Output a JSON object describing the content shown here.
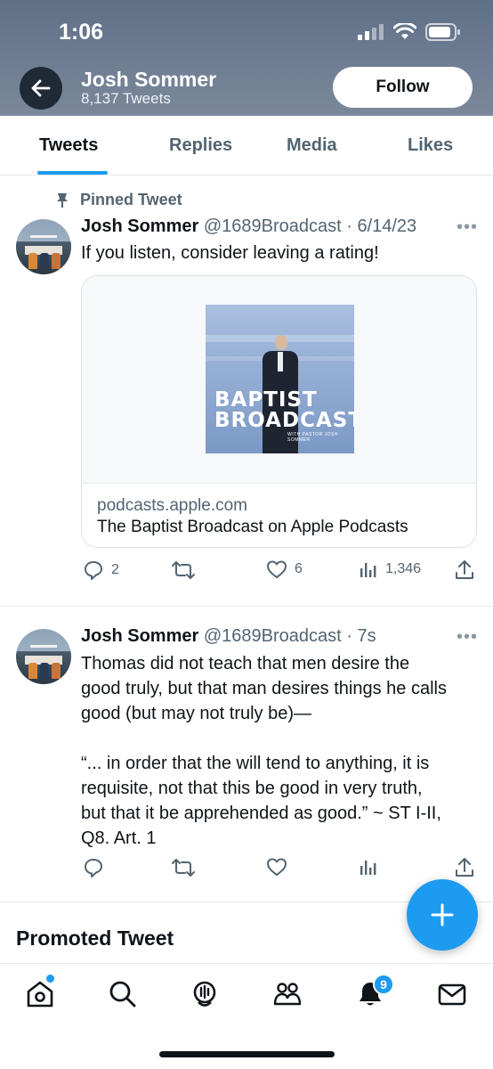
{
  "status_bar": {
    "time": "1:06"
  },
  "profile": {
    "name": "Josh Sommer",
    "tweet_count": "8,137 Tweets",
    "follow_label": "Follow"
  },
  "tabs": [
    {
      "label": "Tweets",
      "active": true
    },
    {
      "label": "Replies",
      "active": false
    },
    {
      "label": "Media",
      "active": false
    },
    {
      "label": "Likes",
      "active": false
    }
  ],
  "pinned_tweet": {
    "pinned_label": "Pinned Tweet",
    "author": "Josh Sommer",
    "meta": "@1689Broadcast · 6/14/23",
    "text": "If you listen, consider leaving a rating!",
    "card": {
      "cover_title_line1": "BAPTIST",
      "cover_title_line2": "BROADCAST.",
      "cover_subtitle": "WITH PASTOR JOSH SOMMER",
      "domain": "podcasts.apple.com",
      "title": "The Baptist Broadcast on Apple Podcasts"
    },
    "actions": {
      "replies": "2",
      "retweets": "",
      "likes": "6",
      "views": "1,346"
    }
  },
  "tweet2": {
    "author": "Josh Sommer",
    "meta": "@1689Broadcast · 7s",
    "text_line1": "Thomas did not teach that men desire the",
    "text_line2": "good truly, but that man desires things he calls",
    "text_line3": "good (but may not truly be)—",
    "text_line4": "“... in order that the will tend to anything, it is",
    "text_line5": "requisite, not that this be good in very truth,",
    "text_line6": "but that it be apprehended as good.” ~ ST I-II,",
    "text_line7": "Q8. Art. 1"
  },
  "promoted": {
    "label": "Promoted Tweet"
  },
  "nav": {
    "notifications_badge": "9"
  },
  "colors": {
    "accent": "#1d9bf0",
    "header_bg": "#6f7e93",
    "text_secondary": "#536471"
  }
}
